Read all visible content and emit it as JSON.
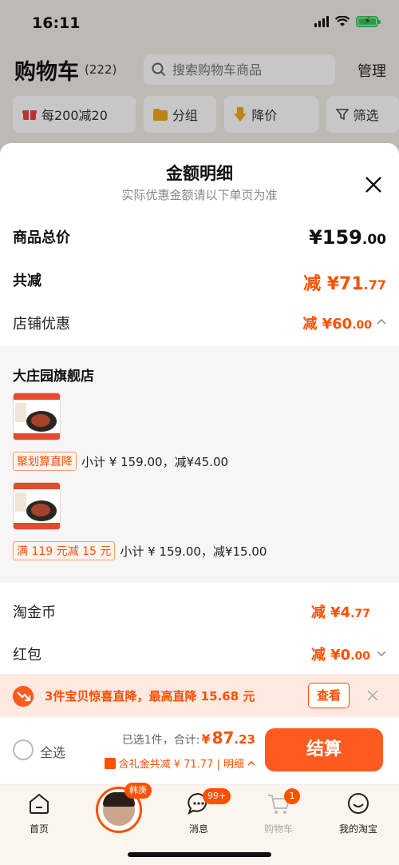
{
  "status_bar": {
    "time": "16:11"
  },
  "cart_header": {
    "title": "购物车",
    "count": "(222)",
    "search_placeholder": "搜索购物车商品",
    "manage_label": "管理"
  },
  "filters": [
    {
      "label": "每200减20",
      "icon": "gift-icon"
    },
    {
      "label": "分组",
      "icon": "folder-icon"
    },
    {
      "label": "降价",
      "icon": "arrow-down-icon"
    },
    {
      "label": "筛选",
      "icon": "filter-icon"
    }
  ],
  "sheet": {
    "title": "金额明细",
    "subtitle": "实际优惠金额请以下单页为准",
    "total_label": "商品总价",
    "total_currency": "¥",
    "total_int": "159",
    "total_dec": ".00",
    "reduce_label": "共减",
    "reduce_prefix": "减 ¥",
    "reduce_int": "71",
    "reduce_dec": ".77",
    "shop_label": "店铺优惠",
    "shop_prefix": "减 ¥",
    "shop_int": "60",
    "shop_dec": ".00",
    "store_name": "大庄园旗舰店",
    "items": [
      {
        "promo_tag": "聚划算直降",
        "promo_text": "小计 ¥ 159.00，减¥45.00"
      },
      {
        "promo_tag": "满 119 元减 15 元",
        "promo_text": "小计 ¥ 159.00，减¥15.00"
      }
    ],
    "coin_label": "淘金币",
    "coin_prefix": "减 ¥",
    "coin_int": "4",
    "coin_dec": ".77",
    "redpack_label": "红包",
    "redpack_prefix": "减 ¥",
    "redpack_int": "0",
    "redpack_dec": ".00"
  },
  "banner": {
    "text": "3件宝贝惊喜直降，最高直降 15.68 元",
    "button": "查看"
  },
  "checkout": {
    "select_all": "全选",
    "selected_text": "已选1件，合计:",
    "currency": "¥",
    "amount_int": "87",
    "amount_dec": ".23",
    "gift_text": "含礼金共减 ¥ 71.77 | 明细",
    "pay_label": "结算"
  },
  "tabbar": {
    "home": "首页",
    "avatar_tag": "韩庚",
    "messages": "消息",
    "messages_badge": "99+",
    "cart": "购物车",
    "cart_badge": "1",
    "mine": "我的淘宝"
  },
  "colors": {
    "accent": "#ff5000",
    "banner_bg": "#ffe9e0",
    "tabbar_bg": "#faf6ee"
  }
}
